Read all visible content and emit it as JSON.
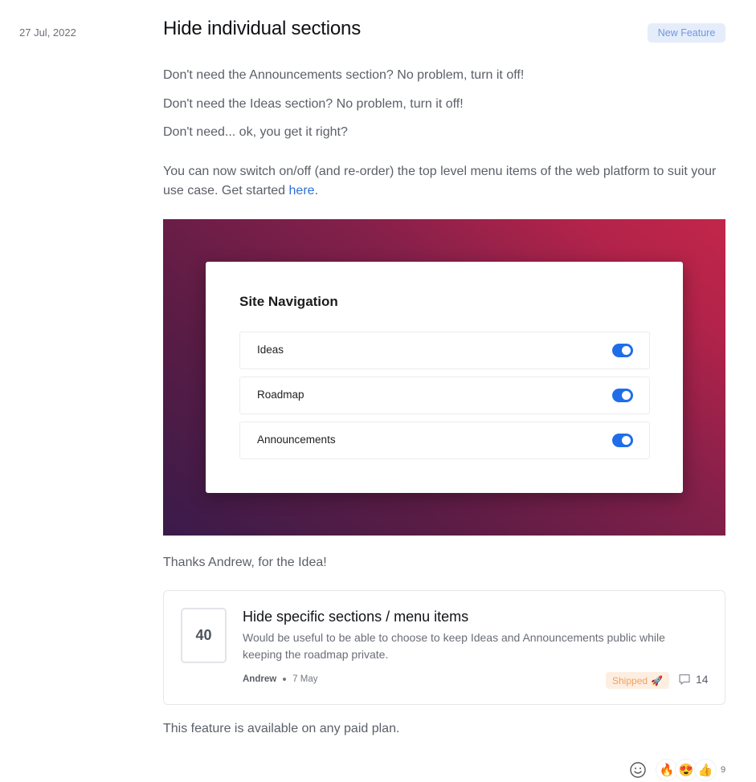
{
  "post": {
    "date": "27 Jul, 2022",
    "title": "Hide individual sections",
    "badge": "New Feature",
    "paragraphs": [
      "Don't need the Announcements section? No problem, turn it off!",
      "Don't need the Ideas section? No problem, turn it off!",
      "Don't need... ok, you get it right?"
    ],
    "body_text": "You can now switch on/off (and re-order) the top level menu items of the web platform to suit your use case. Get started ",
    "link_text": "here",
    "body_end": ".",
    "thanks": "Thanks Andrew, for the Idea!",
    "footer": "This feature is available on any paid plan."
  },
  "hero": {
    "panel_title": "Site Navigation",
    "items": [
      {
        "label": "Ideas",
        "enabled": true
      },
      {
        "label": "Roadmap",
        "enabled": true
      },
      {
        "label": "Announcements",
        "enabled": true
      }
    ]
  },
  "idea": {
    "votes": "40",
    "title": "Hide specific sections / menu items",
    "description": "Would be useful to be able to choose to keep Ideas and Announcements public while keeping the roadmap private.",
    "author": "Andrew",
    "date": "7 May",
    "status": "Shipped",
    "status_icon": "🚀",
    "comments": "14"
  },
  "reactions": {
    "icons": [
      "🔥",
      "😍",
      "👍"
    ],
    "count": "9"
  },
  "colors": {
    "accent": "#1f6ee8",
    "link": "#2c6fd9",
    "badge_bg": "#e5edfb",
    "status_bg": "#fdeee1",
    "status_text": "#f3a15b"
  }
}
